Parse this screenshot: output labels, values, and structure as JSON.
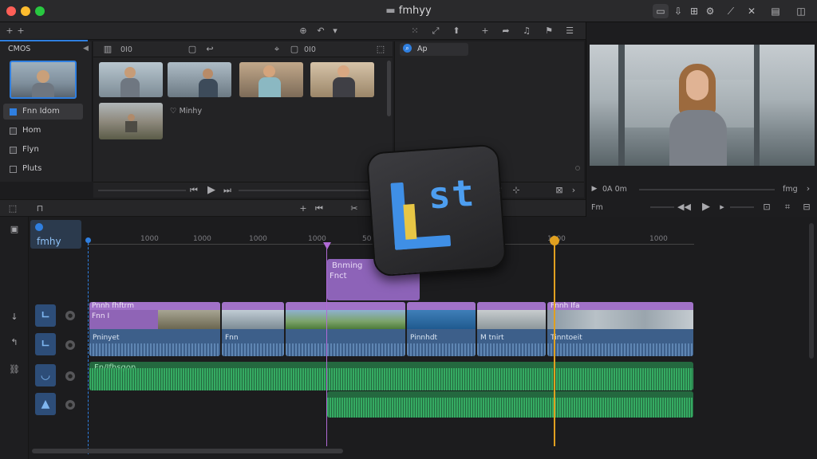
{
  "window": {
    "title": "fmhyy"
  },
  "browser": {
    "header": "CMOS",
    "sidebar_items": [
      "Fnn Idom",
      "Hom",
      "Flyn",
      "Pluts"
    ],
    "toolbar_left_value": "0I0",
    "toolbar_mid_value": "0I0",
    "search_value": "Ap",
    "media_label": "Minhy"
  },
  "viewer": {
    "timecode": "0A 0m",
    "zoom": "fmg",
    "label": "Fm"
  },
  "timeline": {
    "project_name": "fmhy",
    "ruler_labels": [
      "1000",
      "1000",
      "1000",
      "1000",
      "50",
      "1000",
      "1000"
    ],
    "effect_clip": {
      "line1": "Bnming",
      "line2": "Fnct"
    },
    "video_clips": [
      {
        "top": "Pnnh fhftrm",
        "sub": "Fnn I",
        "bottom": "Pninyet"
      },
      {
        "top": "",
        "sub": "",
        "bottom": "Fnn"
      },
      {
        "top": "",
        "sub": "",
        "bottom": ""
      },
      {
        "top": "",
        "sub": "",
        "bottom": "Pinnhdt"
      },
      {
        "top": "",
        "sub": "",
        "bottom": "M tnirt"
      },
      {
        "top": "Fnnh Ifa",
        "sub": "",
        "bottom": "Tinntoeit"
      }
    ],
    "audio_label": "Fn/Ifhsgon"
  },
  "overlay": {
    "logo_text": "st"
  },
  "colors": {
    "accent": "#2f7fe0",
    "playhead": "#e0a020",
    "effect": "#9a6ac8",
    "audio": "#2e9e55",
    "clip": "#3d5f8a"
  }
}
